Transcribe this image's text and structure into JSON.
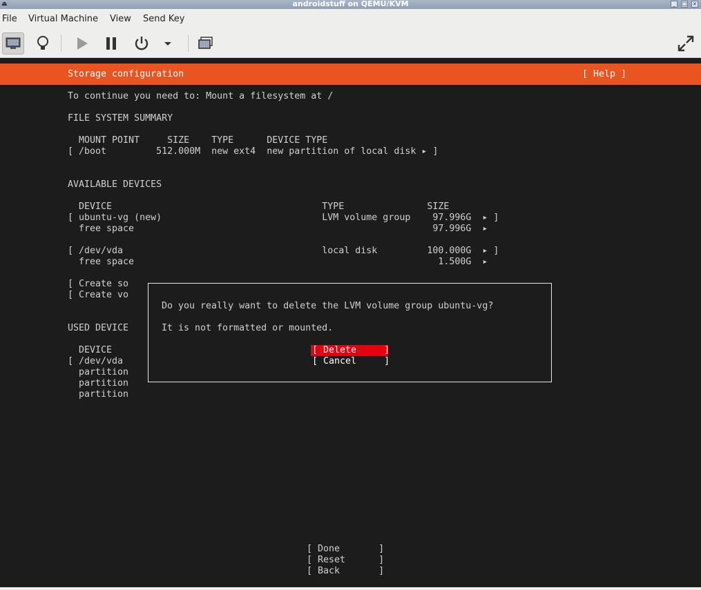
{
  "window": {
    "title": "androidstuff on QEMU/KVM"
  },
  "menubar": [
    "File",
    "Virtual Machine",
    "View",
    "Send Key"
  ],
  "toolbar": {
    "icons": [
      "monitor-icon",
      "lightbulb-icon",
      "play-icon",
      "pause-icon",
      "power-icon",
      "chevron-down-icon",
      "screenshot-icon",
      "fullscreen-icon"
    ]
  },
  "installer": {
    "header_title": "Storage configuration",
    "help_label": "[ Help ]",
    "instruction": "To continue you need to: Mount a filesystem at /",
    "fs_summary": {
      "heading": "FILE SYSTEM SUMMARY",
      "columns_line": "  MOUNT POINT     SIZE    TYPE      DEVICE TYPE",
      "rows": [
        "[ /boot         512.000M  new ext4  new partition of local disk ▸ ]"
      ]
    },
    "available": {
      "heading": "AVAILABLE DEVICES",
      "columns_line": "  DEVICE                                      TYPE               SIZE",
      "rows": [
        "[ ubuntu-vg (new)                             LVM volume group    97.996G  ▸ ]",
        "  free space                                                      97.996G  ▸",
        "",
        "[ /dev/vda                                    local disk         100.000G  ▸ ]",
        "  free space                                                       1.500G  ▸"
      ]
    },
    "create_rows": [
      "[ Create so",
      "[ Create vo"
    ],
    "used": {
      "heading": "USED DEVICE",
      "rows": [
        "  DEVICE",
        "[ /dev/vda",
        "  partition",
        "  partition",
        "  partition"
      ]
    },
    "dialog": {
      "question": "Do you really want to delete the LVM volume group ubuntu-vg?",
      "note": "It is not formatted or mounted.",
      "delete_label": "[ Delete     ]",
      "cancel_label": "[ Cancel     ]"
    },
    "footer": {
      "done_label": "[ Done       ]",
      "reset_label": "[ Reset      ]",
      "back_label": "[ Back       ]"
    }
  },
  "colors": {
    "accent": "#e95420",
    "danger": "#e3000f",
    "console_bg": "#1c1c1c"
  }
}
